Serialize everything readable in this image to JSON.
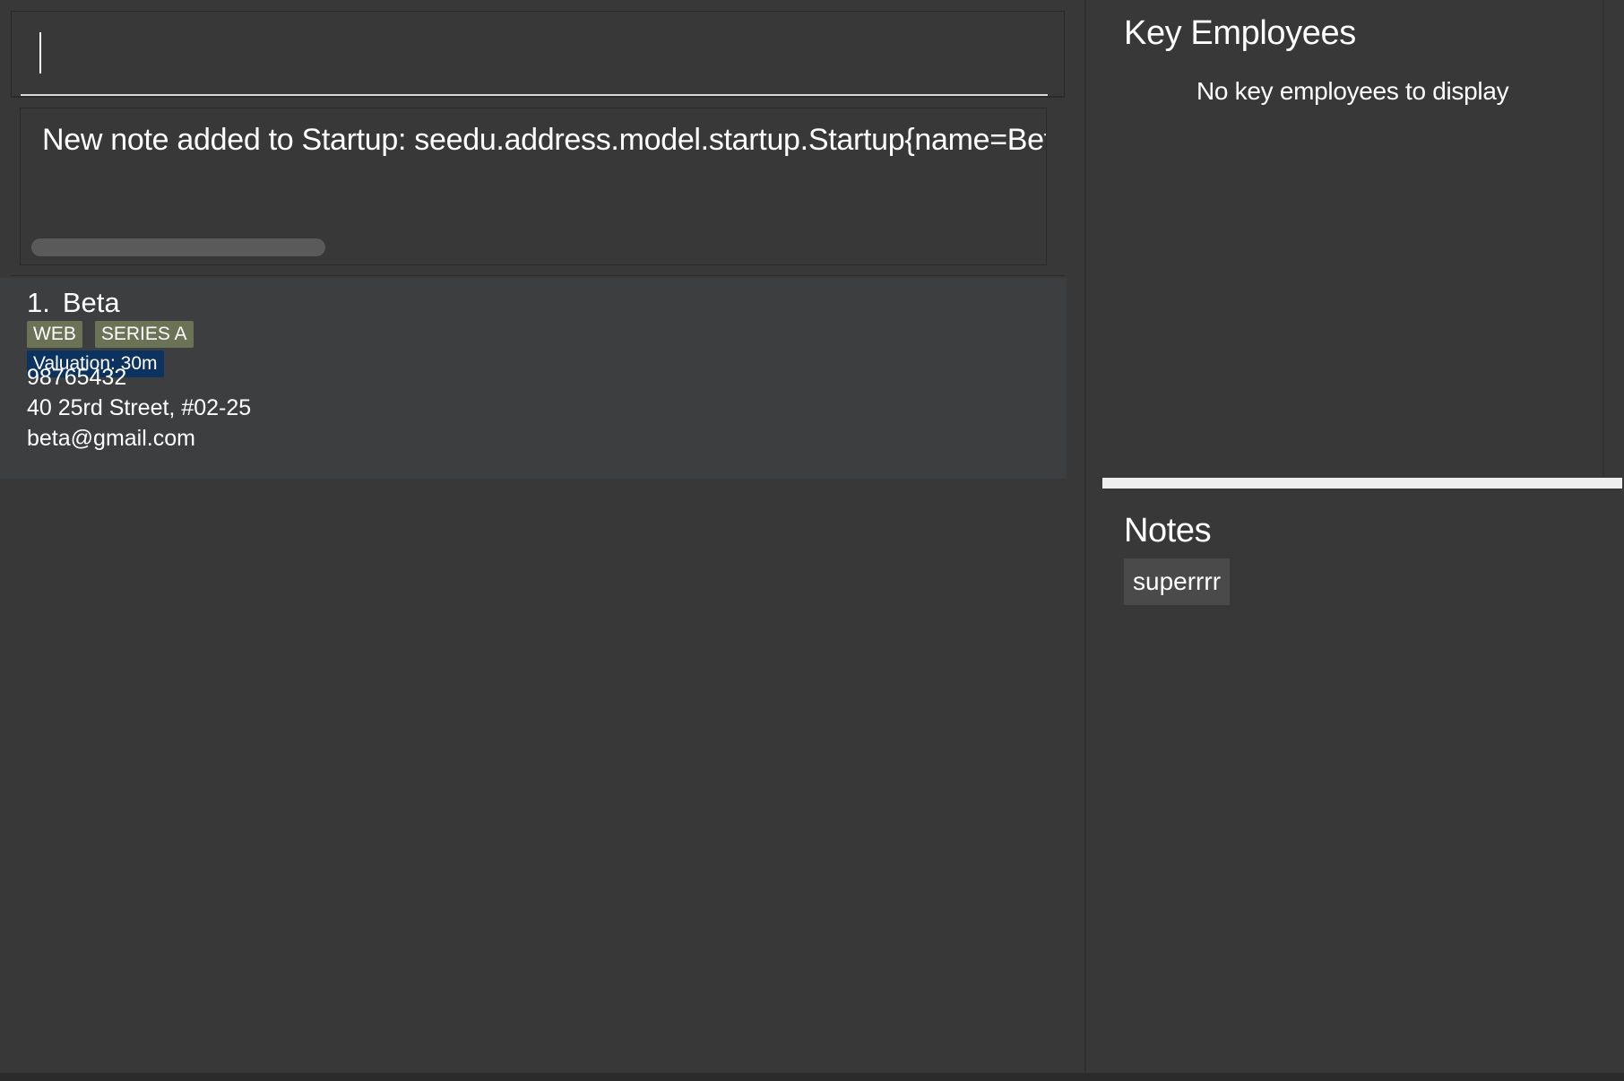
{
  "command_box": {
    "value": "",
    "placeholder": ""
  },
  "result_display": {
    "text": "New note added to Startup: seedu.address.model.startup.Startup{name=Beta"
  },
  "startup_list": [
    {
      "index": "1.",
      "name": "Beta",
      "tags": [
        "WEB",
        "SERIES A"
      ],
      "valuation": "Valuation: 30m",
      "phone": "98765432",
      "address": "40 25rd Street, #02-25",
      "email": "beta@gmail.com"
    }
  ],
  "key_employees": {
    "heading": "Key Employees",
    "empty_message": "No key employees to display"
  },
  "notes": {
    "heading": "Notes",
    "items": [
      "superrrr"
    ]
  },
  "colors": {
    "background": "#383838",
    "card_background": "#3c3e3f",
    "tag_background": "#6b7356",
    "valuation_background": "#0c3260",
    "note_background": "#4a4a4a",
    "separator": "#eeeeee"
  }
}
